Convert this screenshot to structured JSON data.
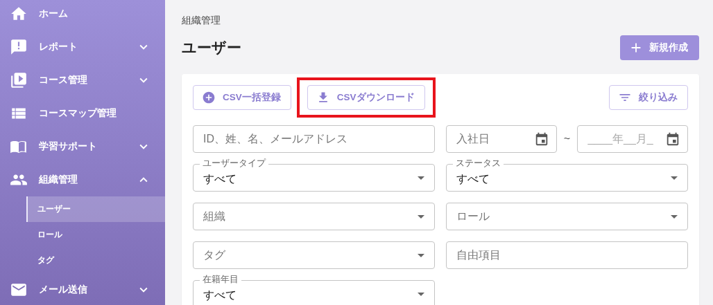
{
  "sidebar": {
    "items": [
      {
        "label": "ホーム"
      },
      {
        "label": "レポート",
        "expanded": false
      },
      {
        "label": "コース管理",
        "expanded": false
      },
      {
        "label": "コースマップ管理"
      },
      {
        "label": "学習サポート",
        "expanded": false
      },
      {
        "label": "組織管理",
        "expanded": true,
        "children": [
          {
            "label": "ユーザー",
            "selected": true
          },
          {
            "label": "ロール",
            "selected": false
          },
          {
            "label": "タグ",
            "selected": false
          }
        ]
      },
      {
        "label": "メール送信",
        "expanded": false
      }
    ]
  },
  "breadcrumb": "組織管理",
  "page_title": "ユーザー",
  "new_button": {
    "label": "新規作成"
  },
  "toolbar": [
    {
      "label": "CSV一括登録",
      "highlighted": false
    },
    {
      "label": "CSVダウンロード",
      "highlighted": true
    }
  ],
  "filter_button": {
    "label": "絞り込み"
  },
  "filters": [
    [
      {
        "kind": "text",
        "placeholder": "ID、姓、名、メールアドレス"
      },
      {
        "kind": "date_range",
        "from": {
          "placeholder": "入社日"
        },
        "separator": "~",
        "to": {
          "placeholder": "____年__月_"
        }
      }
    ],
    [
      {
        "kind": "select",
        "label": "ユーザータイプ",
        "value": "すべて"
      },
      {
        "kind": "select",
        "label": "ステータス",
        "value": "すべて"
      }
    ],
    [
      {
        "kind": "select",
        "placeholder": "組織"
      },
      {
        "kind": "select",
        "placeholder": "ロール"
      }
    ],
    [
      {
        "kind": "select",
        "placeholder": "タグ"
      },
      {
        "kind": "text",
        "placeholder": "自由項目"
      }
    ],
    [
      {
        "kind": "select",
        "label": "在籍年目",
        "value": "すべて"
      }
    ]
  ]
}
